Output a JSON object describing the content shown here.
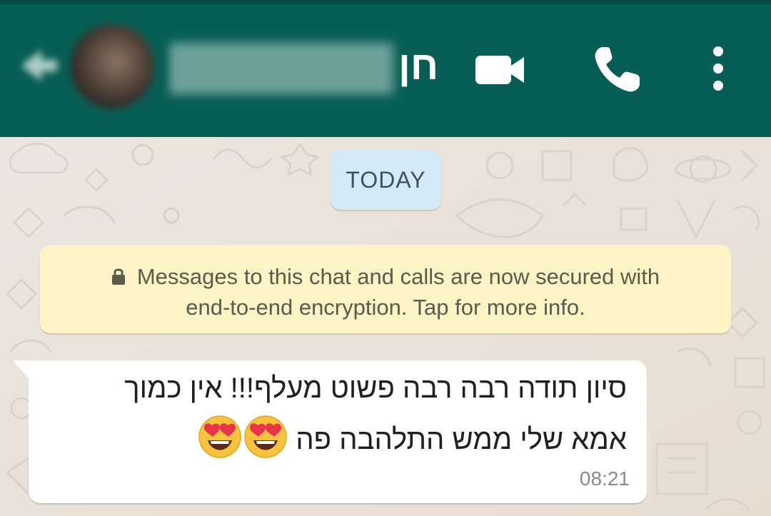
{
  "header": {
    "contact_name_visible": "חן",
    "icons": {
      "back": "arrow-back-icon",
      "video": "video-call-icon",
      "call": "phone-icon",
      "menu": "more-vert-icon"
    },
    "colors": {
      "bar": "#075e54",
      "icon": "#ffffff"
    }
  },
  "chat": {
    "date_chip": "TODAY",
    "system_banner": {
      "line1": "Messages to this chat and calls are now secured with",
      "line2": "end-to-end encryption. Tap for more info.",
      "icon": "lock-icon"
    },
    "messages": [
      {
        "line1": "סיון תודה רבה רבה פשוט מעלף!!! אין כמוך",
        "line2": "אמא שלי ממש התלהבה פה",
        "emoji": [
          "heart-eyes-emoji",
          "heart-eyes-emoji"
        ],
        "time": "08:21"
      }
    ]
  }
}
